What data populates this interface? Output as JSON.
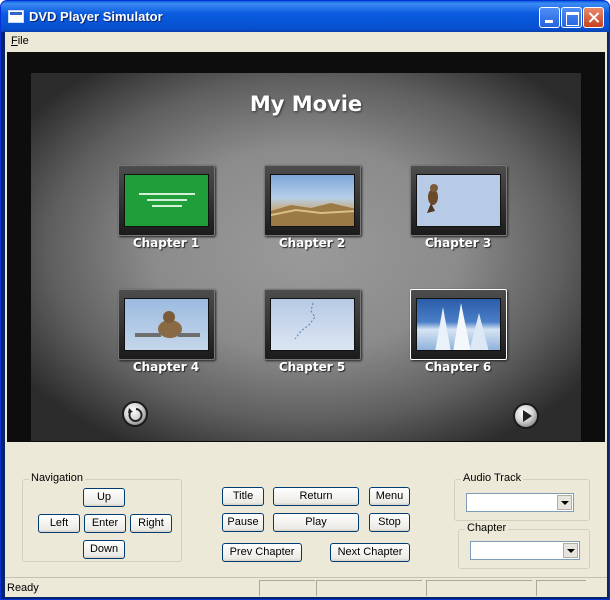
{
  "window": {
    "title": "DVD Player Simulator"
  },
  "menu": {
    "file": "File"
  },
  "dvd": {
    "title": "My Movie",
    "chapters": [
      {
        "label": "Chapter 1",
        "selected": false
      },
      {
        "label": "Chapter 2",
        "selected": false
      },
      {
        "label": "Chapter 3",
        "selected": false
      },
      {
        "label": "Chapter 4",
        "selected": false
      },
      {
        "label": "Chapter 5",
        "selected": false
      },
      {
        "label": "Chapter 6",
        "selected": true
      }
    ]
  },
  "navigation": {
    "label": "Navigation",
    "up": "Up",
    "left": "Left",
    "enter": "Enter",
    "right": "Right",
    "down": "Down"
  },
  "playback": {
    "title": "Title",
    "return": "Return",
    "menu": "Menu",
    "pause": "Pause",
    "play": "Play",
    "stop": "Stop",
    "prev_chapter": "Prev Chapter",
    "next_chapter": "Next Chapter"
  },
  "audio_track": {
    "label": "Audio Track",
    "value": ""
  },
  "chapter_select": {
    "label": "Chapter",
    "value": ""
  },
  "status": {
    "text": "Ready"
  }
}
